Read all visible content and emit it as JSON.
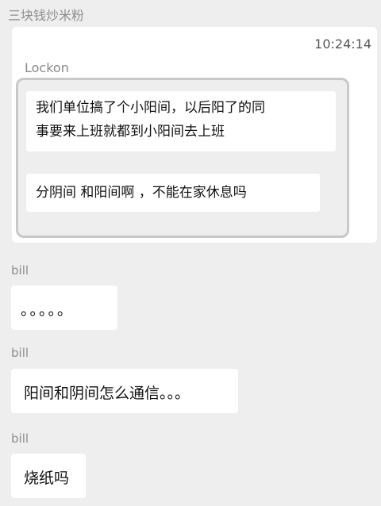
{
  "header": {
    "group_name": "三块钱炒米粉"
  },
  "quoted": {
    "timestamp": "10:24:14",
    "sender": "Lockon",
    "messages": [
      {
        "line1": "我们单位搞了个小阳间，以后阳了的同",
        "line2": "事要来上班就都到小阳间去上班"
      },
      {
        "text": "分阴间 和阳间啊 ，不能在家休息吗"
      }
    ]
  },
  "messages": [
    {
      "sender": "bill",
      "text": "。。。。。"
    },
    {
      "sender": "bill",
      "text": "阳间和阴间怎么通信。。。"
    },
    {
      "sender": "bill",
      "text": "烧纸吗"
    }
  ]
}
